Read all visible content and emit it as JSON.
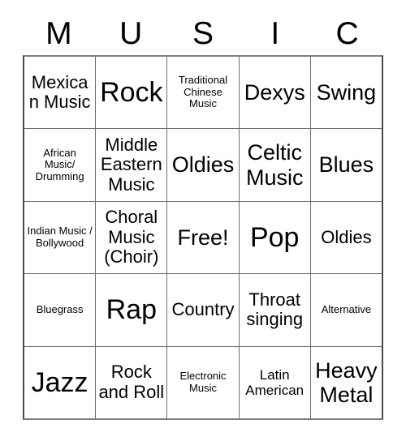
{
  "card": {
    "title": "MUSIC",
    "header_letters": [
      "M",
      "U",
      "S",
      "I",
      "C"
    ],
    "free_space_label": "Free!",
    "grid_size": "5x5",
    "colors": {
      "background": "#ffffff",
      "cell_background": "#ffffff",
      "border": "#6e6e6e",
      "outer_border": "#4a4a4a",
      "text": "#000000"
    }
  },
  "grid": {
    "rows": [
      {
        "cells": [
          {
            "label": "Mexican Music",
            "size": "md"
          },
          {
            "label": "Rock",
            "size": "xl"
          },
          {
            "label": "Traditional Chinese Music",
            "size": "xs"
          },
          {
            "label": "Dexys",
            "size": "lg"
          },
          {
            "label": "Swing",
            "size": "lg"
          }
        ]
      },
      {
        "cells": [
          {
            "label": "African Music/ Drumming",
            "size": "xs"
          },
          {
            "label": "Middle Eastern Music",
            "size": "md"
          },
          {
            "label": "Oldies",
            "size": "lg"
          },
          {
            "label": "Celtic Music",
            "size": "lg"
          },
          {
            "label": "Blues",
            "size": "lg"
          }
        ]
      },
      {
        "cells": [
          {
            "label": "Indian Music / Bollywood",
            "size": "xs"
          },
          {
            "label": "Choral Music (Choir)",
            "size": "md"
          },
          {
            "label": "Free!",
            "size": "lg"
          },
          {
            "label": "Pop",
            "size": "xl"
          },
          {
            "label": "Oldies",
            "size": "md"
          }
        ]
      },
      {
        "cells": [
          {
            "label": "Bluegrass",
            "size": "xs"
          },
          {
            "label": "Rap",
            "size": "xl"
          },
          {
            "label": "Country",
            "size": "md"
          },
          {
            "label": "Throat singing",
            "size": "md"
          },
          {
            "label": "Alternative",
            "size": "xs"
          }
        ]
      },
      {
        "cells": [
          {
            "label": "Jazz",
            "size": "xl"
          },
          {
            "label": "Rock and Roll",
            "size": "md"
          },
          {
            "label": "Electronic Music",
            "size": "xs"
          },
          {
            "label": "Latin American",
            "size": "sm"
          },
          {
            "label": "Heavy Metal",
            "size": "lg"
          }
        ]
      }
    ]
  }
}
